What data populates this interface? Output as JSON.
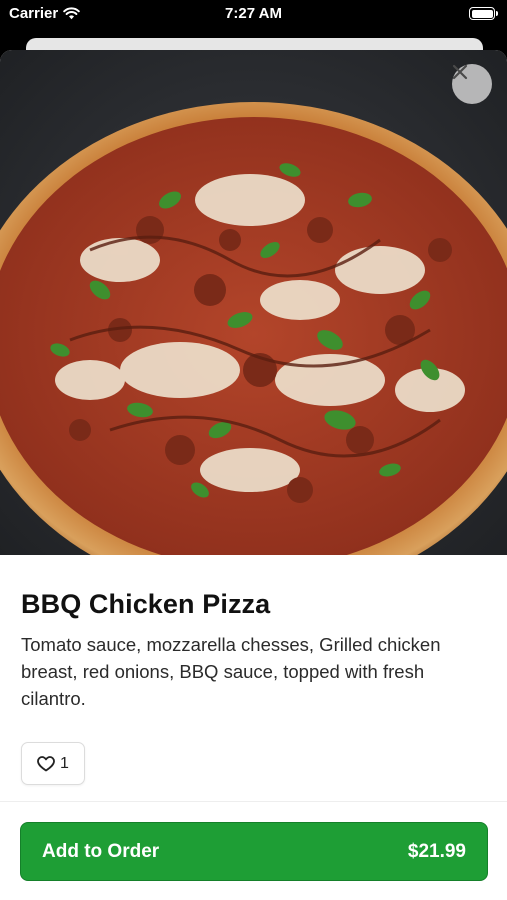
{
  "status_bar": {
    "carrier": "Carrier",
    "time": "7:27 AM"
  },
  "item": {
    "name": "BBQ Chicken Pizza",
    "description": "Tomato sauce, mozzarella chesses, Grilled chicken breast, red onions, BBQ sauce, topped with fresh cilantro.",
    "likes": "1"
  },
  "order": {
    "button_label": "Add to Order",
    "price": "$21.99"
  },
  "icons": {
    "close": "close-icon",
    "like": "heart-icon",
    "wifi": "wifi-icon",
    "battery": "battery-icon"
  },
  "colors": {
    "accent": "#1e9e35"
  }
}
